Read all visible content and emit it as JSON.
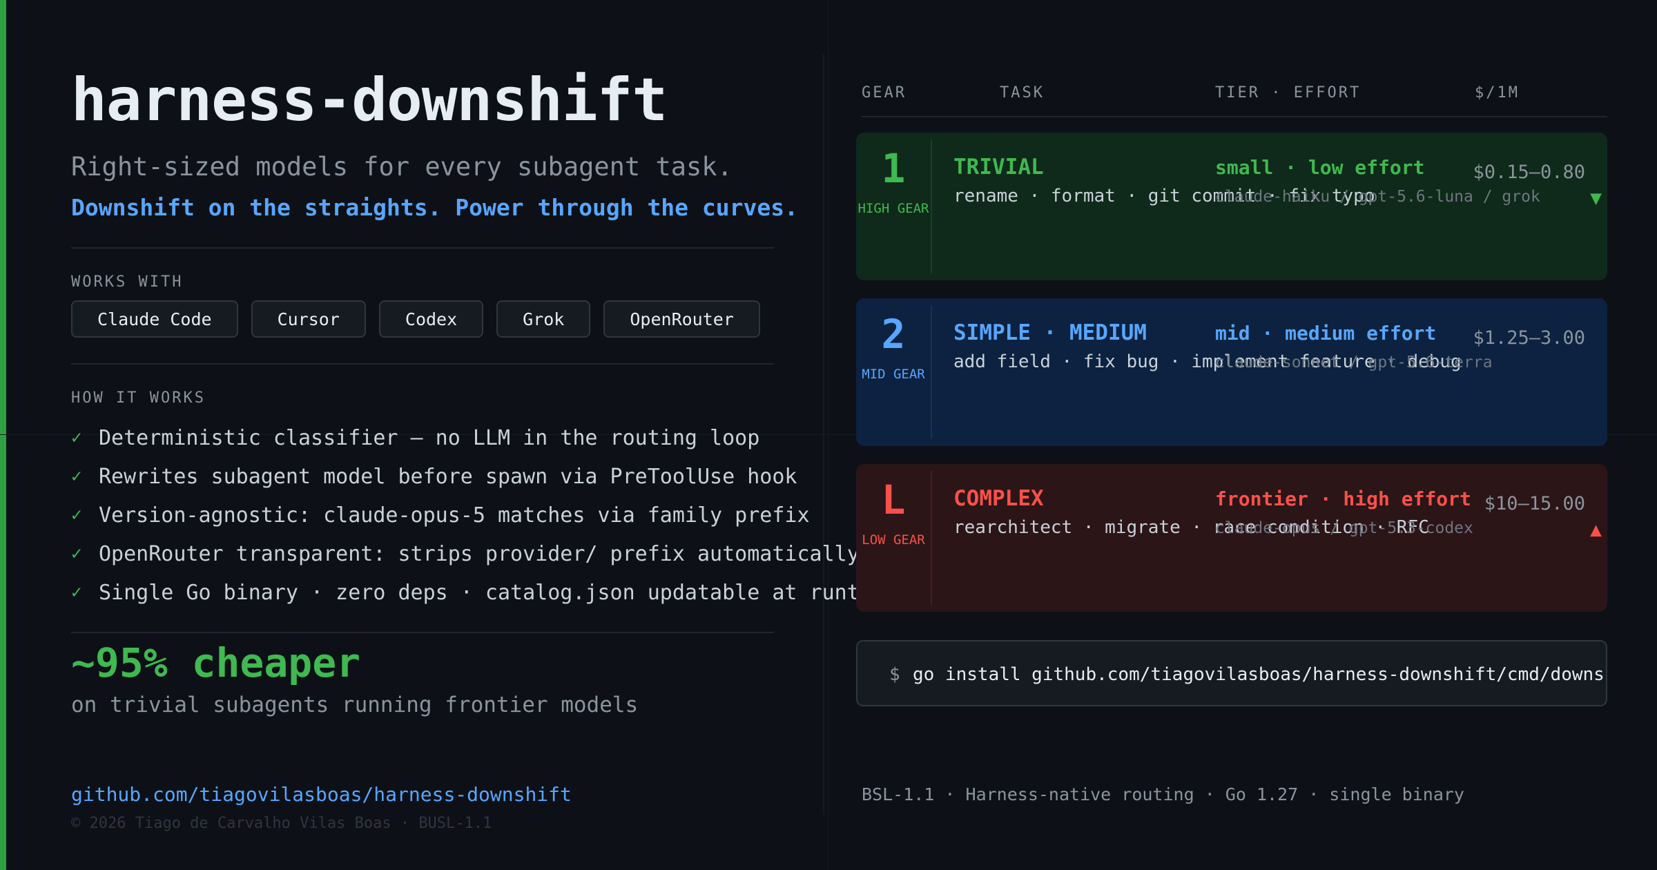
{
  "header": {
    "title": "harness-downshift",
    "subtitle": "Right-sized models for every subagent task.",
    "tagline": "Downshift on the straights. Power through the curves."
  },
  "works_with": {
    "label": "WORKS WITH",
    "items": [
      "Claude Code",
      "Cursor",
      "Codex",
      "Grok",
      "OpenRouter"
    ]
  },
  "how_it_works": {
    "label": "HOW IT WORKS",
    "check_glyph": "✓",
    "items": [
      "Deterministic classifier — no LLM in the routing loop",
      "Rewrites subagent model before spawn via PreToolUse hook",
      "Version-agnostic: claude-opus-5 matches via family prefix",
      "OpenRouter transparent: strips provider/ prefix automatically",
      "Single Go binary · zero deps · catalog.json updatable at runtime"
    ]
  },
  "savings": {
    "headline": "~95% cheaper",
    "detail": "on trivial subagents running frontier models"
  },
  "footer_left": {
    "link": "github.com/tiagovilasboas/harness-downshift",
    "copyright": "© 2026 Tiago de Carvalho Vilas Boas · BUSL-1.1"
  },
  "table": {
    "headers": {
      "gear": "GEAR",
      "task": "TASK",
      "tier": "TIER · EFFORT",
      "price": "$/1M"
    },
    "rows": [
      {
        "gear": "1",
        "gear_label": "HIGH GEAR",
        "task": "TRIVIAL",
        "examples": "rename · format · git commit · fix typo",
        "tier": "small · low effort",
        "models": "claude-haiku / gpt-5.6-luna / grok",
        "price": "$0.15–0.80",
        "arrow": "▼",
        "color": "#3fb950"
      },
      {
        "gear": "2",
        "gear_label": "MID GEAR",
        "task": "SIMPLE · MEDIUM",
        "examples": "add field · fix bug · implement feature · debug",
        "tier": "mid · medium effort",
        "models": "claude-sonnet / gpt-5.6-terra",
        "price": "$1.25–3.00",
        "arrow": "",
        "color": "#58a6ff"
      },
      {
        "gear": "L",
        "gear_label": "LOW GEAR",
        "task": "COMPLEX",
        "examples": "rearchitect · migrate · race condition · RFC",
        "tier": "frontier · high effort",
        "models": "claude-opus / gpt-5.3-codex",
        "price": "$10–15.00",
        "arrow": "▲",
        "color": "#f85149"
      }
    ]
  },
  "install": {
    "prompt": "$",
    "command": "go install github.com/tiagovilasboas/harness-downshift/cmd/downshift@latest"
  },
  "footer_right": "BSL-1.1 · Harness-native routing · Go 1.27 · single binary"
}
